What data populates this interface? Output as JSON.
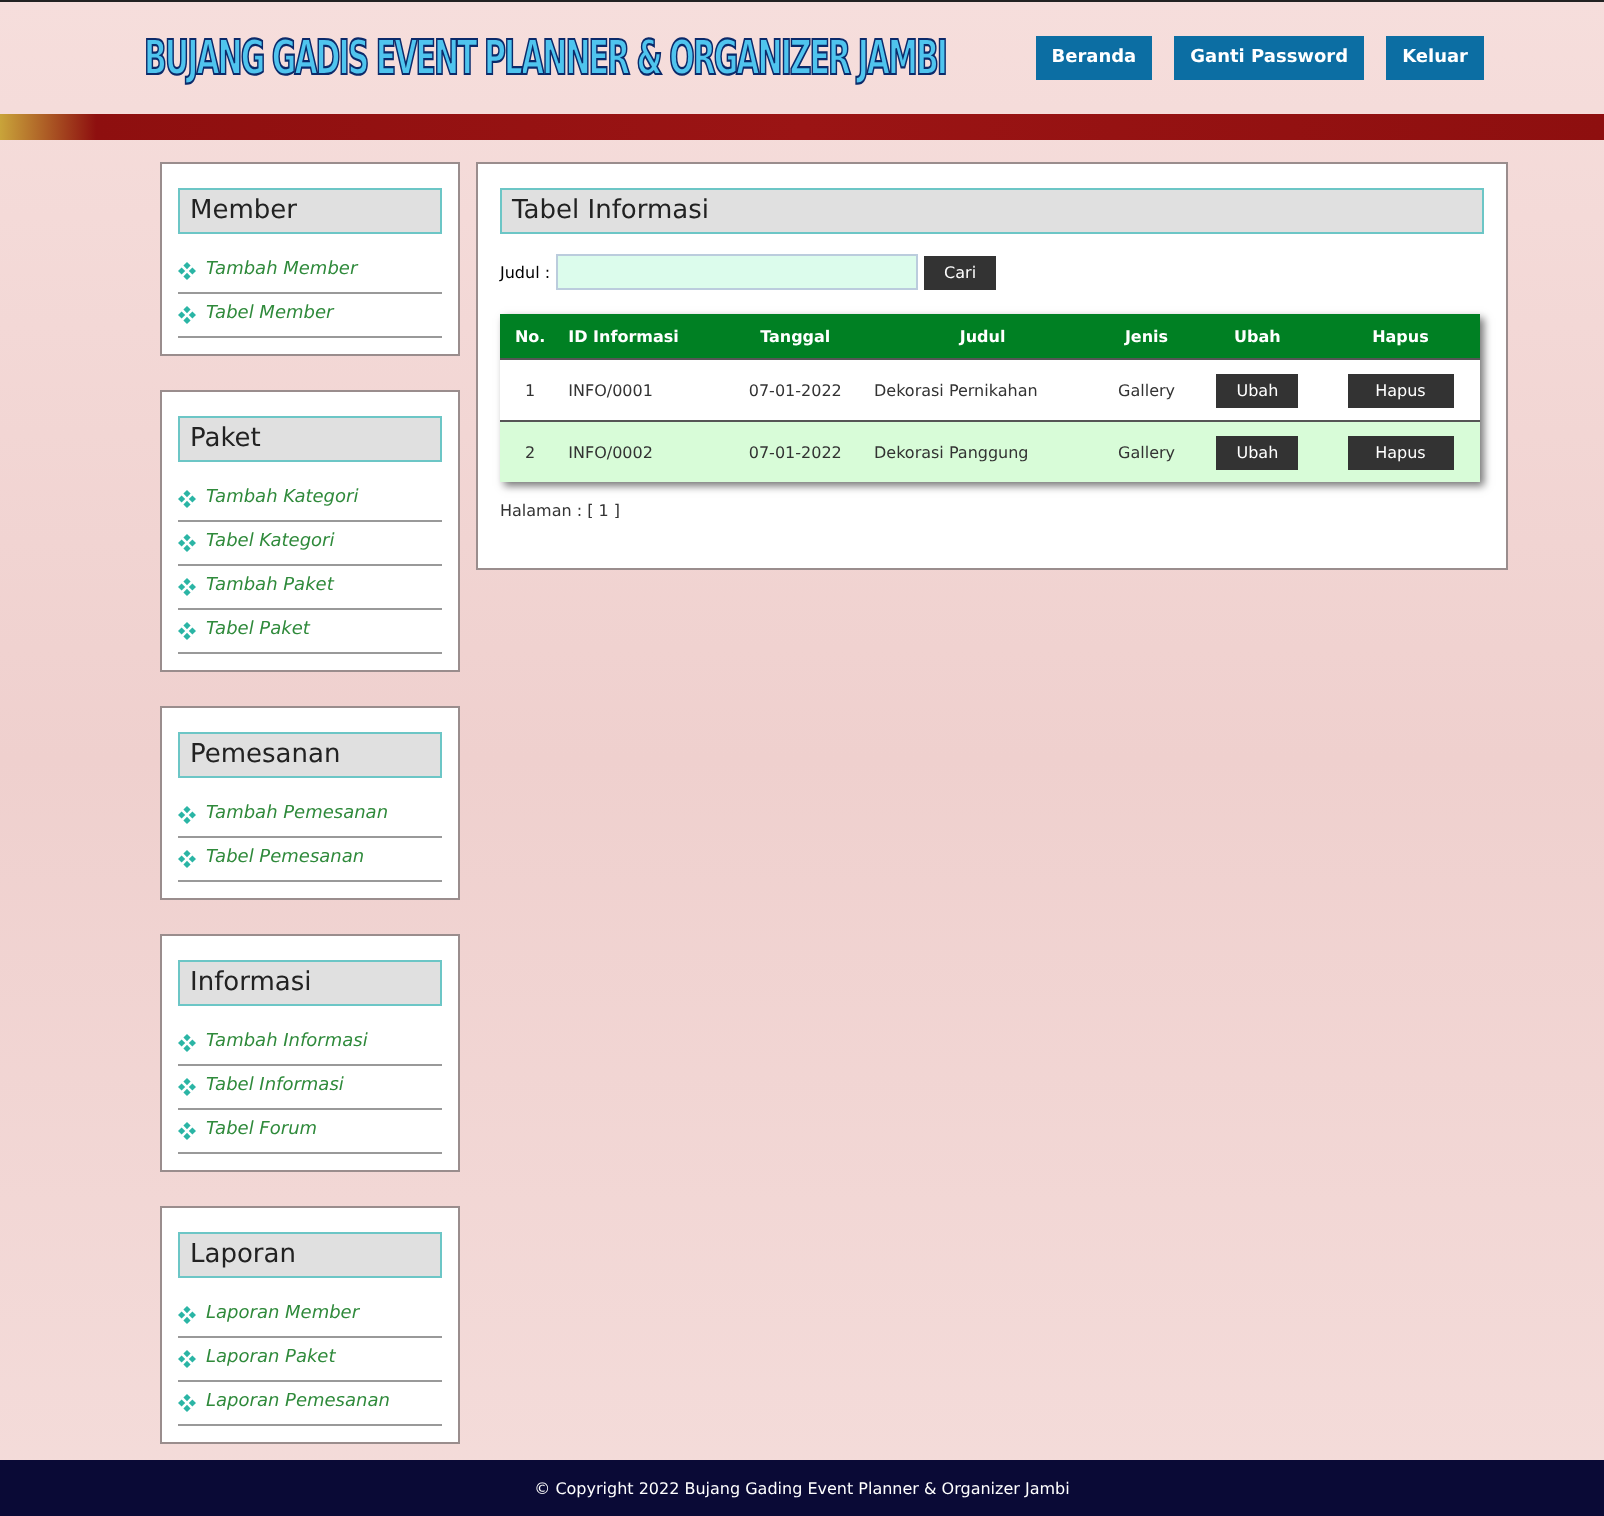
{
  "header": {
    "title": "BUJANG GADIS EVENT PLANNER & ORGANIZER JAMBI",
    "nav": [
      "Beranda",
      "Ganti Password",
      "Keluar"
    ]
  },
  "sidebar": [
    {
      "title": "Member",
      "items": [
        "Tambah Member",
        "Tabel Member"
      ]
    },
    {
      "title": "Paket",
      "items": [
        "Tambah Kategori",
        "Tabel Kategori",
        "Tambah Paket",
        "Tabel Paket"
      ]
    },
    {
      "title": "Pemesanan",
      "items": [
        "Tambah Pemesanan",
        "Tabel Pemesanan"
      ]
    },
    {
      "title": "Informasi",
      "items": [
        "Tambah Informasi",
        "Tabel Informasi",
        "Tabel Forum"
      ]
    },
    {
      "title": "Laporan",
      "items": [
        "Laporan Member",
        "Laporan Paket",
        "Laporan Pemesanan"
      ]
    }
  ],
  "main": {
    "title": "Tabel Informasi",
    "search": {
      "label": "Judul :",
      "button": "Cari"
    },
    "table": {
      "columns": [
        "No.",
        "ID Informasi",
        "Tanggal",
        "Judul",
        "Jenis",
        "Ubah",
        "Hapus"
      ],
      "rows": [
        {
          "no": "1",
          "id": "INFO/0001",
          "tanggal": "07-01-2022",
          "judul": "Dekorasi Pernikahan",
          "jenis": "Gallery",
          "edit": "Ubah",
          "delete": "Hapus"
        },
        {
          "no": "2",
          "id": "INFO/0002",
          "tanggal": "07-01-2022",
          "judul": "Dekorasi Panggung",
          "jenis": "Gallery",
          "edit": "Ubah",
          "delete": "Hapus"
        }
      ]
    },
    "pagination": "Halaman : [ 1 ]"
  },
  "footer": "© Copyright 2022 Bujang Gading Event Planner & Organizer Jambi"
}
